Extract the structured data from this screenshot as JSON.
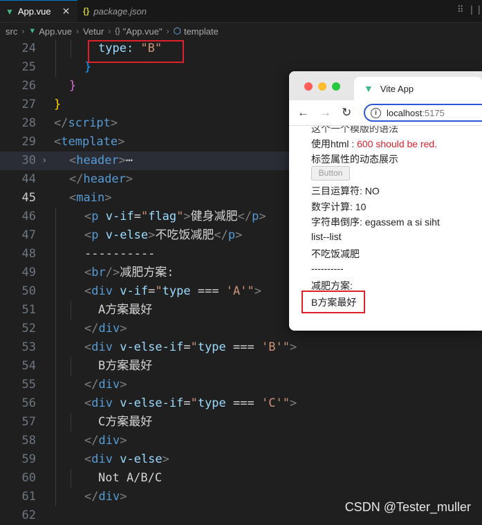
{
  "tabs": [
    {
      "label": "App.vue",
      "icon": "vue-icon",
      "close": "✕"
    },
    {
      "label": "package.json",
      "icon": "json-braces-icon"
    }
  ],
  "breadcrumb": {
    "items": [
      "src",
      "App.vue",
      "Vetur",
      "\"App.vue\"",
      "template"
    ],
    "braces": "{}"
  },
  "editor": {
    "lines": [
      {
        "num": "24",
        "tokens": [
          {
            "t": "type: ",
            "c": "t-attr"
          },
          {
            "t": "\"B\"",
            "c": "t-str"
          }
        ],
        "indent": 64
      },
      {
        "num": "25",
        "tokens": [
          {
            "t": "}",
            "c": "t-brace3"
          }
        ],
        "indent": 44
      },
      {
        "num": "26",
        "tokens": [
          {
            "t": "}",
            "c": "t-brace2"
          }
        ],
        "indent": 22
      },
      {
        "num": "27",
        "tokens": [
          {
            "t": "}",
            "c": "t-brace1"
          }
        ],
        "indent": 0
      },
      {
        "num": "28",
        "tokens": [
          {
            "t": "</",
            "c": "t-br"
          },
          {
            "t": "script",
            "c": "t-tag"
          },
          {
            "t": ">",
            "c": "t-br"
          }
        ],
        "indent": 0
      },
      {
        "num": "29",
        "tokens": [
          {
            "t": "<",
            "c": "t-br"
          },
          {
            "t": "template",
            "c": "t-tag"
          },
          {
            "t": ">",
            "c": "t-br"
          }
        ],
        "indent": 0
      },
      {
        "num": "30",
        "tokens": [
          {
            "t": "<",
            "c": "t-br"
          },
          {
            "t": "header",
            "c": "t-tag"
          },
          {
            "t": ">",
            "c": "t-br"
          },
          {
            "t": "⋯",
            "c": "t-txt"
          }
        ],
        "indent": 22,
        "fold": "›",
        "highlight": true
      },
      {
        "num": "44",
        "tokens": [
          {
            "t": "</",
            "c": "t-br"
          },
          {
            "t": "header",
            "c": "t-tag"
          },
          {
            "t": ">",
            "c": "t-br"
          }
        ],
        "indent": 22
      },
      {
        "num": "45",
        "tokens": [
          {
            "t": "<",
            "c": "t-br"
          },
          {
            "t": "main",
            "c": "t-tag"
          },
          {
            "t": ">",
            "c": "t-br"
          }
        ],
        "indent": 22,
        "current": true
      },
      {
        "num": "46",
        "tokens": [
          {
            "t": "<",
            "c": "t-br"
          },
          {
            "t": "p",
            "c": "t-tag"
          },
          {
            "t": " v-if",
            "c": "t-attr"
          },
          {
            "t": "=",
            "c": "t-txt"
          },
          {
            "t": "\"",
            "c": "t-str"
          },
          {
            "t": "flag",
            "c": "t-attr"
          },
          {
            "t": "\"",
            "c": "t-str"
          },
          {
            "t": ">",
            "c": "t-br"
          },
          {
            "t": "健身减肥",
            "c": "t-txt"
          },
          {
            "t": "</",
            "c": "t-br"
          },
          {
            "t": "p",
            "c": "t-tag"
          },
          {
            "t": ">",
            "c": "t-br"
          }
        ],
        "indent": 44
      },
      {
        "num": "47",
        "tokens": [
          {
            "t": "<",
            "c": "t-br"
          },
          {
            "t": "p",
            "c": "t-tag"
          },
          {
            "t": " v-else",
            "c": "t-attr"
          },
          {
            "t": ">",
            "c": "t-br"
          },
          {
            "t": "不吃饭减肥",
            "c": "t-txt"
          },
          {
            "t": "</",
            "c": "t-br"
          },
          {
            "t": "p",
            "c": "t-tag"
          },
          {
            "t": ">",
            "c": "t-br"
          }
        ],
        "indent": 44
      },
      {
        "num": "48",
        "tokens": [
          {
            "t": "----------",
            "c": "t-txt"
          }
        ],
        "indent": 44
      },
      {
        "num": "49",
        "tokens": [
          {
            "t": "<",
            "c": "t-br"
          },
          {
            "t": "br",
            "c": "t-tag"
          },
          {
            "t": "/>",
            "c": "t-br"
          },
          {
            "t": "减肥方案:",
            "c": "t-txt"
          }
        ],
        "indent": 44
      },
      {
        "num": "50",
        "tokens": [
          {
            "t": "<",
            "c": "t-br"
          },
          {
            "t": "div",
            "c": "t-tag"
          },
          {
            "t": " v-if",
            "c": "t-attr"
          },
          {
            "t": "=",
            "c": "t-txt"
          },
          {
            "t": "\"",
            "c": "t-str"
          },
          {
            "t": "type",
            "c": "t-attr"
          },
          {
            "t": " === ",
            "c": "t-txt"
          },
          {
            "t": "'A'",
            "c": "t-str"
          },
          {
            "t": "\"",
            "c": "t-str"
          },
          {
            "t": ">",
            "c": "t-br"
          }
        ],
        "indent": 44
      },
      {
        "num": "51",
        "tokens": [
          {
            "t": "A方案最好",
            "c": "t-txt"
          }
        ],
        "indent": 64
      },
      {
        "num": "52",
        "tokens": [
          {
            "t": "</",
            "c": "t-br"
          },
          {
            "t": "div",
            "c": "t-tag"
          },
          {
            "t": ">",
            "c": "t-br"
          }
        ],
        "indent": 44
      },
      {
        "num": "53",
        "tokens": [
          {
            "t": "<",
            "c": "t-br"
          },
          {
            "t": "div",
            "c": "t-tag"
          },
          {
            "t": " v-else-if",
            "c": "t-attr"
          },
          {
            "t": "=",
            "c": "t-txt"
          },
          {
            "t": "\"",
            "c": "t-str"
          },
          {
            "t": "type",
            "c": "t-attr"
          },
          {
            "t": " === ",
            "c": "t-txt"
          },
          {
            "t": "'B'",
            "c": "t-str"
          },
          {
            "t": "\"",
            "c": "t-str"
          },
          {
            "t": ">",
            "c": "t-br"
          }
        ],
        "indent": 44
      },
      {
        "num": "54",
        "tokens": [
          {
            "t": "B方案最好",
            "c": "t-txt"
          }
        ],
        "indent": 64
      },
      {
        "num": "55",
        "tokens": [
          {
            "t": "</",
            "c": "t-br"
          },
          {
            "t": "div",
            "c": "t-tag"
          },
          {
            "t": ">",
            "c": "t-br"
          }
        ],
        "indent": 44
      },
      {
        "num": "56",
        "tokens": [
          {
            "t": "<",
            "c": "t-br"
          },
          {
            "t": "div",
            "c": "t-tag"
          },
          {
            "t": " v-else-if",
            "c": "t-attr"
          },
          {
            "t": "=",
            "c": "t-txt"
          },
          {
            "t": "\"",
            "c": "t-str"
          },
          {
            "t": "type",
            "c": "t-attr"
          },
          {
            "t": " === ",
            "c": "t-txt"
          },
          {
            "t": "'C'",
            "c": "t-str"
          },
          {
            "t": "\"",
            "c": "t-str"
          },
          {
            "t": ">",
            "c": "t-br"
          }
        ],
        "indent": 44
      },
      {
        "num": "57",
        "tokens": [
          {
            "t": "C方案最好",
            "c": "t-txt"
          }
        ],
        "indent": 64
      },
      {
        "num": "58",
        "tokens": [
          {
            "t": "</",
            "c": "t-br"
          },
          {
            "t": "div",
            "c": "t-tag"
          },
          {
            "t": ">",
            "c": "t-br"
          }
        ],
        "indent": 44
      },
      {
        "num": "59",
        "tokens": [
          {
            "t": "<",
            "c": "t-br"
          },
          {
            "t": "div",
            "c": "t-tag"
          },
          {
            "t": " v-else",
            "c": "t-attr"
          },
          {
            "t": ">",
            "c": "t-br"
          }
        ],
        "indent": 44
      },
      {
        "num": "60",
        "tokens": [
          {
            "t": "Not A/B/C",
            "c": "t-txt"
          }
        ],
        "indent": 64
      },
      {
        "num": "61",
        "tokens": [
          {
            "t": "</",
            "c": "t-br"
          },
          {
            "t": "div",
            "c": "t-tag"
          },
          {
            "t": ">",
            "c": "t-br"
          }
        ],
        "indent": 44
      },
      {
        "num": "62",
        "tokens": [],
        "indent": 0
      }
    ]
  },
  "browser": {
    "tab_title": "Vite App",
    "url_host": "localhost",
    "url_port": ":5175",
    "page": {
      "line0": "这个一个模版的语法",
      "html_prefix": "使用html : ",
      "html_red": "600 should be red.",
      "attr_line": "标签属性的动态展示",
      "button": "Button",
      "ternary": "三目运算符: NO",
      "math": "数字计算: 10",
      "reverse": "字符串倒序: egassem a si siht",
      "list": "list--list",
      "noeat": "不吃饭减肥",
      "dashes": "----------",
      "plan": "减肥方案:",
      "result": "B方案最好"
    }
  },
  "watermark": "CSDN @Tester_muller",
  "colors": {
    "accent": "#0078d4",
    "highlight_box": "#e0202a",
    "vue_green": "#41b883"
  }
}
